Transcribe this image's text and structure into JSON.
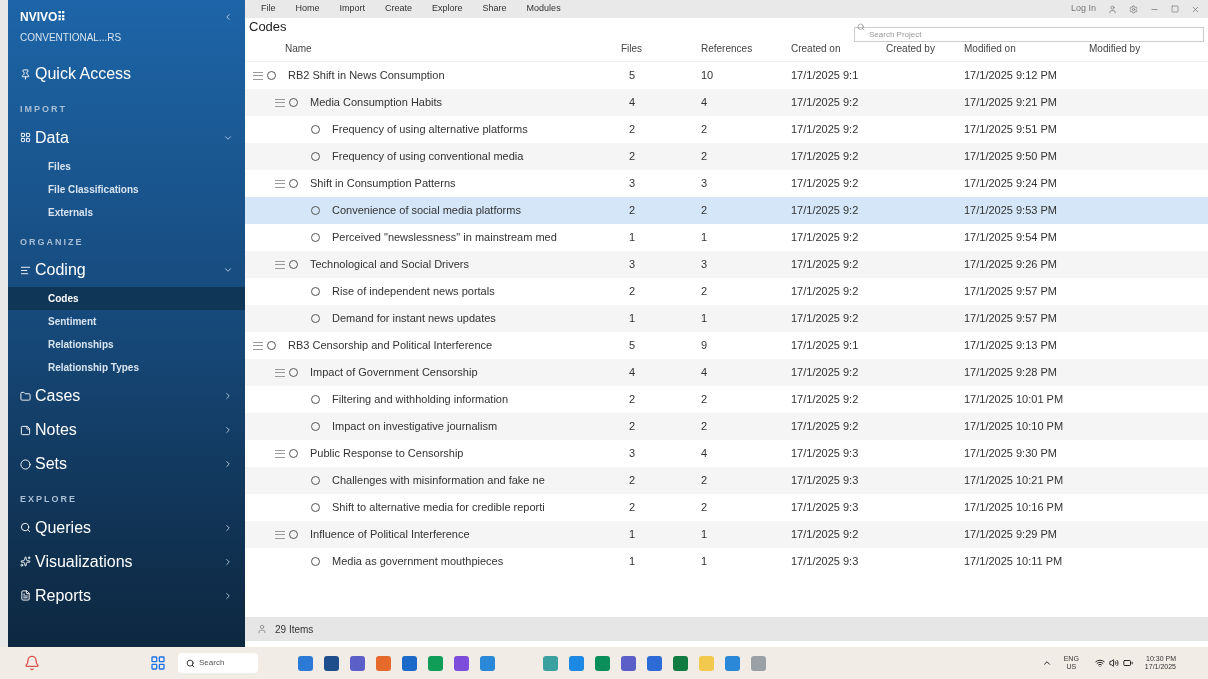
{
  "app": {
    "logo": "NVIVO",
    "glyph": "⠿",
    "project": "CONVENTIONAL...RS"
  },
  "sidebar": [
    {
      "kind": "group",
      "label": "Quick Access"
    },
    {
      "kind": "section",
      "label": "IMPORT"
    },
    {
      "kind": "group",
      "label": "Data",
      "expanded": true
    },
    {
      "kind": "sub",
      "label": "Files",
      "selected": false
    },
    {
      "kind": "sub",
      "label": "File Classifications",
      "selected": false
    },
    {
      "kind": "sub",
      "label": "Externals",
      "selected": false
    },
    {
      "kind": "section",
      "label": "ORGANIZE"
    },
    {
      "kind": "group",
      "label": "Coding",
      "expanded": true
    },
    {
      "kind": "sub",
      "label": "Codes",
      "selected": true
    },
    {
      "kind": "sub",
      "label": "Sentiment",
      "selected": false
    },
    {
      "kind": "sub",
      "label": "Relationships",
      "selected": false
    },
    {
      "kind": "sub",
      "label": "Relationship Types",
      "selected": false
    },
    {
      "kind": "group",
      "label": "Cases",
      "expanded": false
    },
    {
      "kind": "group",
      "label": "Notes",
      "expanded": false
    },
    {
      "kind": "group",
      "label": "Sets",
      "expanded": false
    },
    {
      "kind": "section",
      "label": "EXPLORE"
    },
    {
      "kind": "group",
      "label": "Queries",
      "expanded": false
    },
    {
      "kind": "group",
      "label": "Visualizations",
      "expanded": false
    },
    {
      "kind": "group",
      "label": "Reports",
      "expanded": false
    }
  ],
  "menu": [
    "File",
    "Home",
    "Import",
    "Create",
    "Explore",
    "Share",
    "Modules"
  ],
  "login": "Log In",
  "view_title": "Codes",
  "search": {
    "placeholder": "Search Project"
  },
  "columns": [
    "Name",
    "Files",
    "References",
    "Created on",
    "Created by",
    "Modified on",
    "Modified by"
  ],
  "rows": [
    {
      "name": "RB2 Shift in News Consumption",
      "files": "5",
      "refs": "10",
      "created": "17/1/2025 9:1",
      "modified": "17/1/2025 9:12 PM",
      "selected": false,
      "expanded": true,
      "children": [
        {
          "name": "Media Consumption Habits",
          "files": "4",
          "refs": "4",
          "created": "17/1/2025 9:2",
          "modified": "17/1/2025 9:21 PM",
          "selected": false,
          "expanded": true,
          "children": [
            {
              "name": "Frequency of using alternative platforms",
              "files": "2",
              "refs": "2",
              "created": "17/1/2025 9:2",
              "modified": "17/1/2025 9:51 PM",
              "selected": false
            },
            {
              "name": "Frequency of using conventional media",
              "files": "2",
              "refs": "2",
              "created": "17/1/2025 9:2",
              "modified": "17/1/2025 9:50 PM",
              "selected": false
            }
          ]
        },
        {
          "name": "Shift in Consumption Patterns",
          "files": "3",
          "refs": "3",
          "created": "17/1/2025 9:2",
          "modified": "17/1/2025 9:24 PM",
          "selected": false,
          "expanded": true,
          "children": [
            {
              "name": "Convenience of social media platforms",
              "files": "2",
              "refs": "2",
              "created": "17/1/2025 9:2",
              "modified": "17/1/2025 9:53 PM",
              "selected": true
            },
            {
              "name": "Perceived \"newslessness\" in mainstream med",
              "files": "1",
              "refs": "1",
              "created": "17/1/2025 9:2",
              "modified": "17/1/2025 9:54 PM",
              "selected": false
            }
          ]
        },
        {
          "name": "Technological and Social Drivers",
          "files": "3",
          "refs": "3",
          "created": "17/1/2025 9:2",
          "modified": "17/1/2025 9:26 PM",
          "selected": false,
          "expanded": true,
          "children": [
            {
              "name": "Rise of independent news portals",
              "files": "2",
              "refs": "2",
              "created": "17/1/2025 9:2",
              "modified": "17/1/2025 9:57 PM",
              "selected": false
            },
            {
              "name": "Demand for instant news updates",
              "files": "1",
              "refs": "1",
              "created": "17/1/2025 9:2",
              "modified": "17/1/2025 9:57 PM",
              "selected": false
            }
          ]
        }
      ]
    },
    {
      "name": "RB3 Censorship and Political Interference",
      "files": "5",
      "refs": "9",
      "created": "17/1/2025 9:1",
      "modified": "17/1/2025 9:13 PM",
      "selected": false,
      "expanded": true,
      "children": [
        {
          "name": "Impact of Government Censorship",
          "files": "4",
          "refs": "4",
          "created": "17/1/2025 9:2",
          "modified": "17/1/2025 9:28 PM",
          "selected": false,
          "expanded": true,
          "children": [
            {
              "name": "Filtering and withholding information",
              "files": "2",
              "refs": "2",
              "created": "17/1/2025 9:2",
              "modified": "17/1/2025 10:01 PM",
              "selected": false
            },
            {
              "name": "Impact on investigative journalism",
              "files": "2",
              "refs": "2",
              "created": "17/1/2025 9:2",
              "modified": "17/1/2025 10:10 PM",
              "selected": false
            }
          ]
        },
        {
          "name": "Public Response to Censorship",
          "files": "3",
          "refs": "4",
          "created": "17/1/2025 9:3",
          "modified": "17/1/2025 9:30 PM",
          "selected": false,
          "expanded": true,
          "children": [
            {
              "name": "Challenges with misinformation and fake ne",
              "files": "2",
              "refs": "2",
              "created": "17/1/2025 9:3",
              "modified": "17/1/2025 10:21 PM",
              "selected": false
            },
            {
              "name": "Shift to alternative media for credible reporti",
              "files": "2",
              "refs": "2",
              "created": "17/1/2025 9:3",
              "modified": "17/1/2025 10:16 PM",
              "selected": false
            }
          ]
        },
        {
          "name": "Influence of Political Interference",
          "files": "1",
          "refs": "1",
          "created": "17/1/2025 9:2",
          "modified": "17/1/2025 9:29 PM",
          "selected": false,
          "expanded": true,
          "children": [
            {
              "name": "Media as government mouthpieces",
              "files": "1",
              "refs": "1",
              "created": "17/1/2025 9:3",
              "modified": "17/1/2025 10:11 PM",
              "selected": false
            }
          ]
        }
      ]
    }
  ],
  "status": "29 Items",
  "taskbar": {
    "search": "Search",
    "lang": "ENG",
    "region": "US",
    "time": "10:30 PM",
    "date": "17/1/2025"
  }
}
